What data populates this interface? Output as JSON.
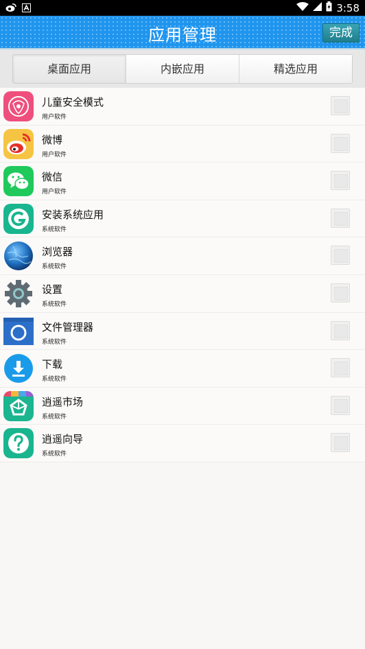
{
  "status_bar": {
    "time": "3:58"
  },
  "header": {
    "title": "应用管理",
    "done_label": "完成"
  },
  "tabs": [
    {
      "label": "桌面应用",
      "selected": true
    },
    {
      "label": "内嵌应用",
      "selected": false
    },
    {
      "label": "精选应用",
      "selected": false
    }
  ],
  "apps": [
    {
      "name": "儿童安全模式",
      "type": "用户软件",
      "icon": "child-safety-icon",
      "checked": false
    },
    {
      "name": "微博",
      "type": "用户软件",
      "icon": "weibo-icon",
      "checked": false
    },
    {
      "name": "微信",
      "type": "用户软件",
      "icon": "wechat-icon",
      "checked": false
    },
    {
      "name": "安装系统应用",
      "type": "系统软件",
      "icon": "install-system-app-icon",
      "checked": false
    },
    {
      "name": "浏览器",
      "type": "系统软件",
      "icon": "browser-globe-icon",
      "checked": false
    },
    {
      "name": "设置",
      "type": "系统软件",
      "icon": "gear-icon",
      "checked": false
    },
    {
      "name": "文件管理器",
      "type": "系统软件",
      "icon": "file-manager-icon",
      "checked": false
    },
    {
      "name": "下载",
      "type": "系统软件",
      "icon": "download-icon",
      "checked": false
    },
    {
      "name": "逍遥市场",
      "type": "系统软件",
      "icon": "app-market-icon",
      "checked": false
    },
    {
      "name": "逍遥向导",
      "type": "系统软件",
      "icon": "help-guide-icon",
      "checked": false
    }
  ],
  "colors": {
    "header": "#1f95ee",
    "done_button": "#2a8f9e",
    "background": "#f8f7f5"
  }
}
